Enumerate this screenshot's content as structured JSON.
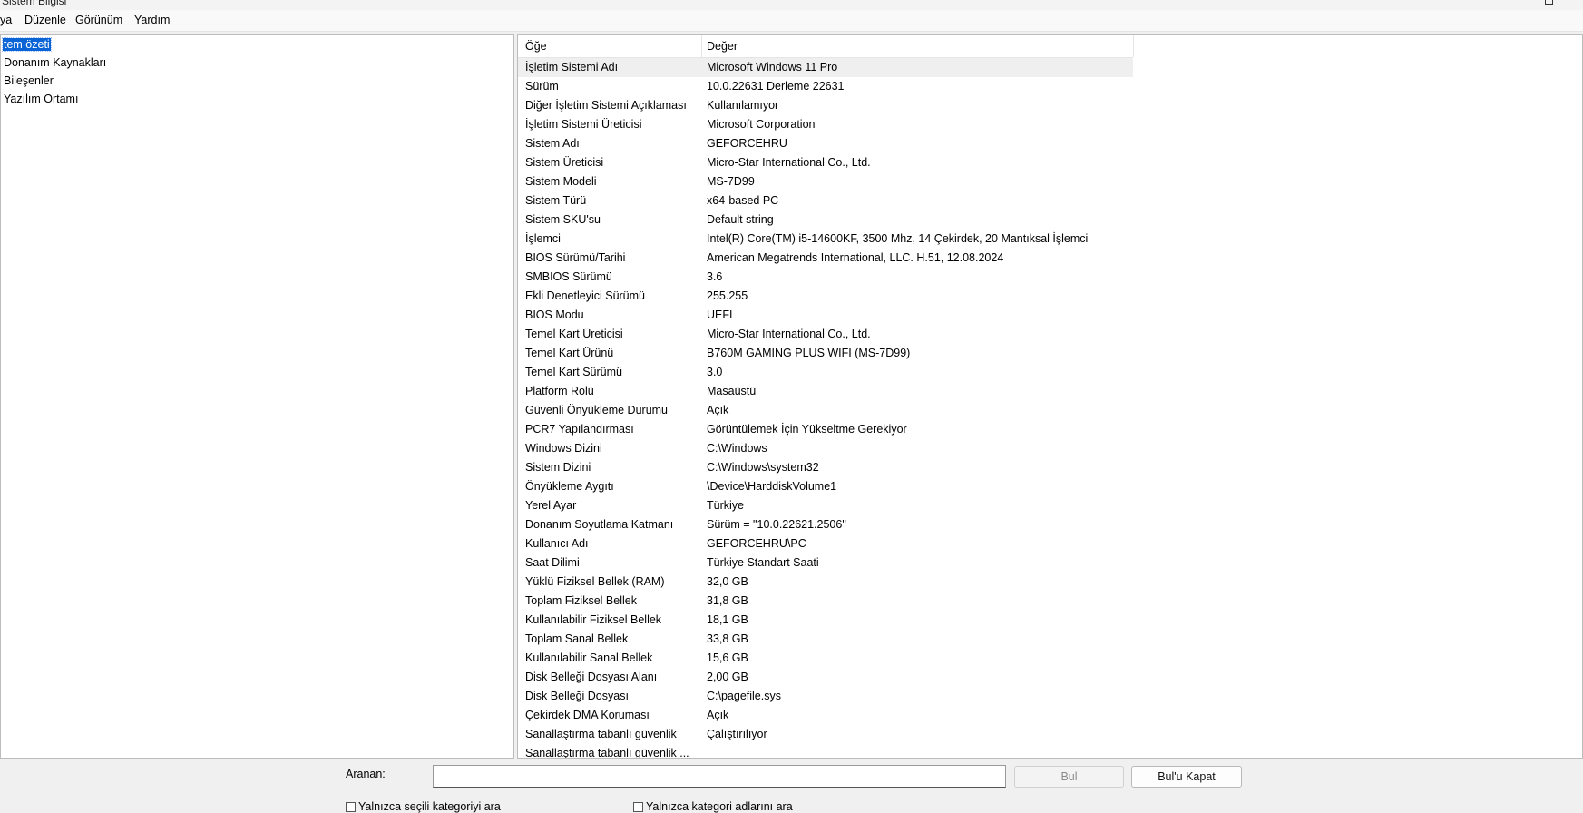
{
  "window": {
    "title": "Sistem Bilgisi"
  },
  "menu": [
    "ya",
    "Düzenle",
    "Görünüm",
    "Yardım"
  ],
  "tree": [
    {
      "label": "tem özeti",
      "selected": true
    },
    {
      "label": "Donanım Kaynakları"
    },
    {
      "label": "Bileşenler"
    },
    {
      "label": "Yazılım Ortamı"
    }
  ],
  "list": {
    "headers": {
      "item": "Öğe",
      "value": "Değer"
    },
    "rows": [
      {
        "item": "İşletim Sistemi Adı",
        "value": "Microsoft Windows 11 Pro"
      },
      {
        "item": "Sürüm",
        "value": "10.0.22631 Derleme 22631"
      },
      {
        "item": "Diğer İşletim Sistemi Açıklaması",
        "value": "Kullanılamıyor"
      },
      {
        "item": "İşletim Sistemi Üreticisi",
        "value": "Microsoft Corporation"
      },
      {
        "item": "Sistem Adı",
        "value": "GEFORCEHRU"
      },
      {
        "item": "Sistem Üreticisi",
        "value": "Micro-Star International Co., Ltd."
      },
      {
        "item": "Sistem Modeli",
        "value": "MS-7D99"
      },
      {
        "item": "Sistem Türü",
        "value": "x64-based PC"
      },
      {
        "item": "Sistem SKU'su",
        "value": "Default string"
      },
      {
        "item": "İşlemci",
        "value": "Intel(R) Core(TM) i5-14600KF, 3500 Mhz, 14 Çekirdek, 20 Mantıksal İşlemci"
      },
      {
        "item": "BIOS Sürümü/Tarihi",
        "value": "American Megatrends International, LLC. H.51, 12.08.2024"
      },
      {
        "item": "SMBIOS Sürümü",
        "value": "3.6"
      },
      {
        "item": "Ekli Denetleyici Sürümü",
        "value": "255.255"
      },
      {
        "item": "BIOS Modu",
        "value": "UEFI"
      },
      {
        "item": "Temel Kart Üreticisi",
        "value": "Micro-Star International Co., Ltd."
      },
      {
        "item": "Temel Kart Ürünü",
        "value": "B760M GAMING PLUS WIFI (MS-7D99)"
      },
      {
        "item": "Temel Kart Sürümü",
        "value": "3.0"
      },
      {
        "item": "Platform Rolü",
        "value": "Masaüstü"
      },
      {
        "item": "Güvenli Önyükleme Durumu",
        "value": "Açık"
      },
      {
        "item": "PCR7 Yapılandırması",
        "value": "Görüntülemek İçin Yükseltme Gerekiyor"
      },
      {
        "item": "Windows Dizini",
        "value": "C:\\Windows"
      },
      {
        "item": "Sistem Dizini",
        "value": "C:\\Windows\\system32"
      },
      {
        "item": "Önyükleme Aygıtı",
        "value": "\\Device\\HarddiskVolume1"
      },
      {
        "item": "Yerel Ayar",
        "value": "Türkiye"
      },
      {
        "item": "Donanım Soyutlama Katmanı",
        "value": "Sürüm = \"10.0.22621.2506\""
      },
      {
        "item": "Kullanıcı Adı",
        "value": "GEFORCEHRU\\PC"
      },
      {
        "item": "Saat Dilimi",
        "value": "Türkiye Standart Saati"
      },
      {
        "item": "Yüklü Fiziksel Bellek (RAM)",
        "value": "32,0 GB"
      },
      {
        "item": "Toplam Fiziksel Bellek",
        "value": "31,8 GB"
      },
      {
        "item": "Kullanılabilir Fiziksel Bellek",
        "value": "18,1 GB"
      },
      {
        "item": "Toplam Sanal Bellek",
        "value": "33,8 GB"
      },
      {
        "item": "Kullanılabilir Sanal Bellek",
        "value": "15,6 GB"
      },
      {
        "item": "Disk Belleği Dosyası Alanı",
        "value": "2,00 GB"
      },
      {
        "item": "Disk Belleği Dosyası",
        "value": "C:\\pagefile.sys"
      },
      {
        "item": "Çekirdek DMA Koruması",
        "value": "Açık"
      },
      {
        "item": "Sanallaştırma tabanlı güvenlik",
        "value": "Çalıştırılıyor"
      },
      {
        "item": "Sanallaştırma tabanlı güvenlik ...",
        "value": ""
      }
    ]
  },
  "search": {
    "label": "Aranan:",
    "value": "",
    "find_button": "Bul",
    "close_button": "Bul'u Kapat",
    "checkbox_selected_category": "Yalnızca seçili kategoriyi ara",
    "checkbox_category_names": "Yalnızca kategori adlarını ara"
  }
}
